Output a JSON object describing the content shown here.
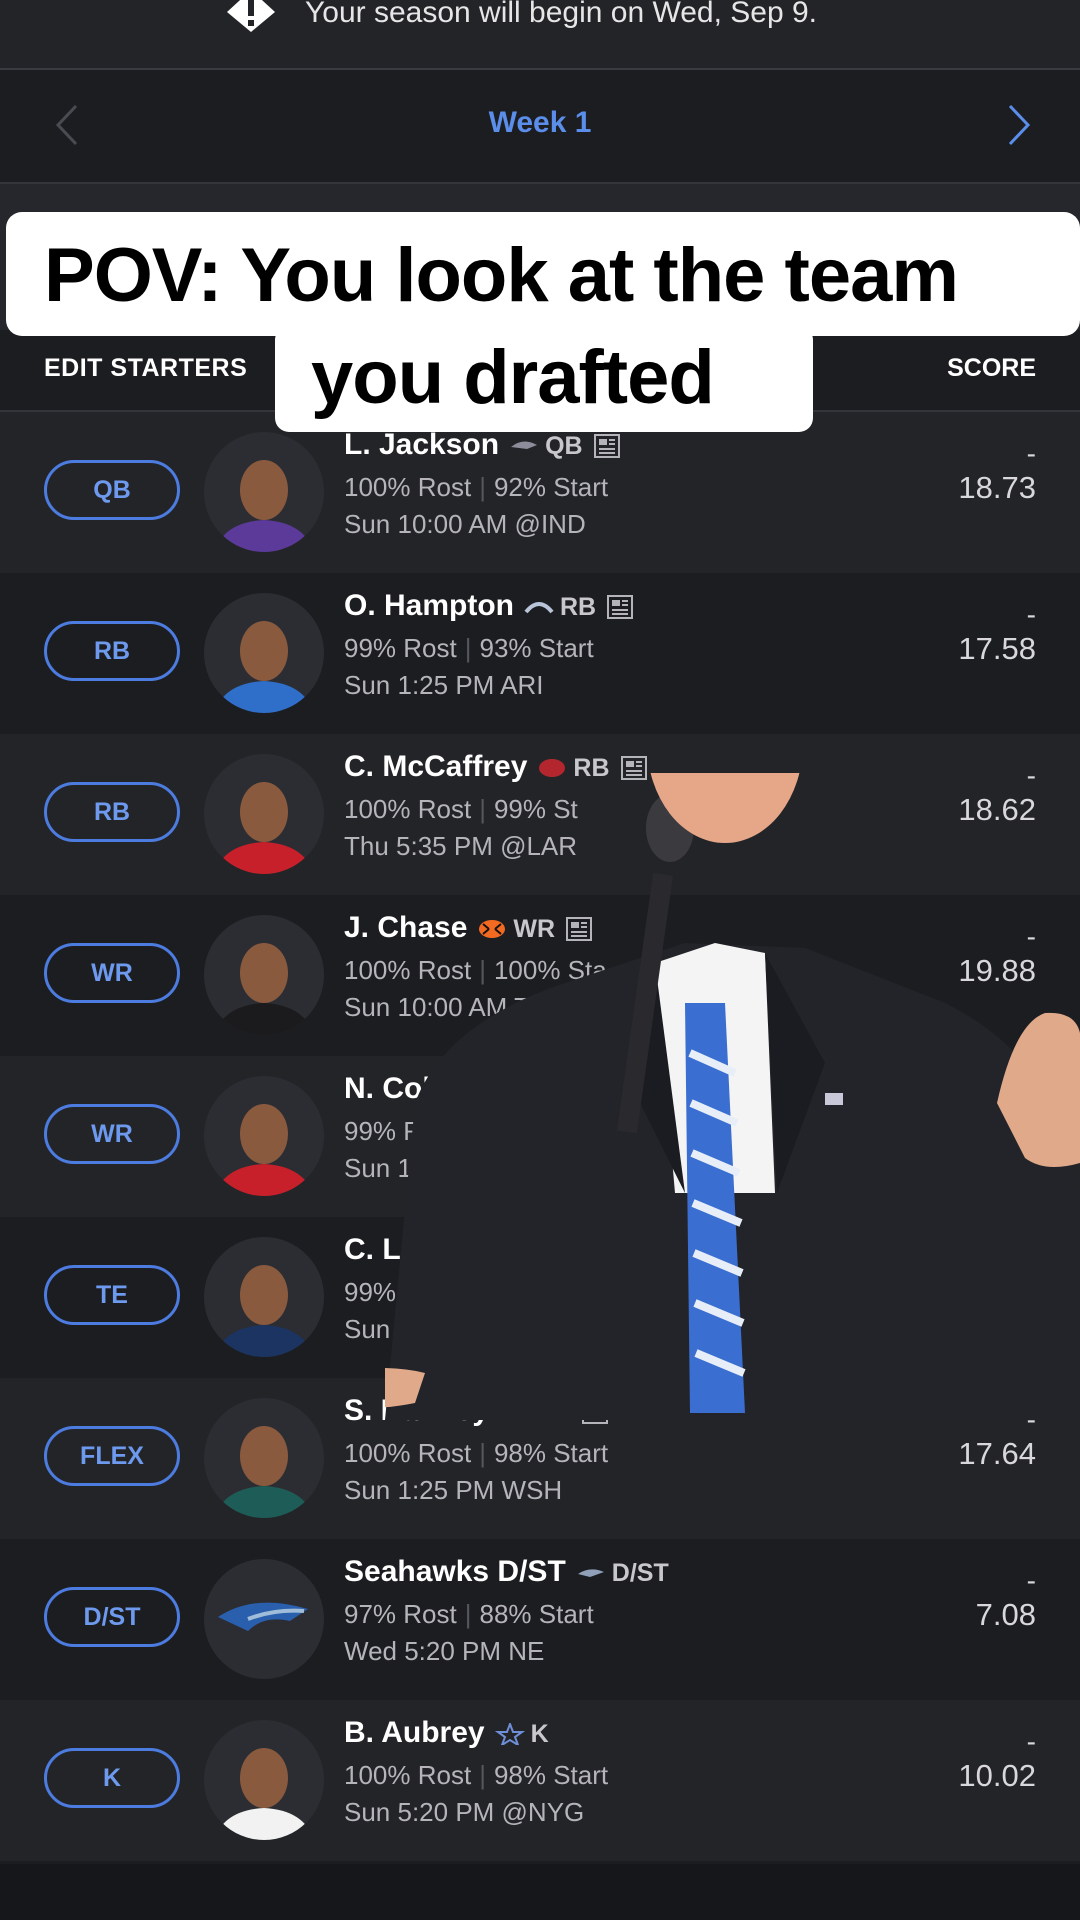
{
  "notice": {
    "text": "Your season will begin on Wed, Sep 9.",
    "icon": "alert-icon"
  },
  "week": {
    "label": "Week 1"
  },
  "caption": {
    "line1": "POV: You look at the team",
    "line2": "you drafted"
  },
  "table_header": {
    "edit_starters": "EDIT STARTERS",
    "score": "SCORE"
  },
  "colors": {
    "accent": "#5b8eea",
    "background": "#1c1d21",
    "row_alt": "#232428"
  },
  "players": [
    {
      "slot": "QB",
      "name": "L. Jackson",
      "position": "QB",
      "rost": "100% Rost",
      "start": "92% Start",
      "game": "Sun 10:00 AM @IND",
      "score": "-",
      "projection": "18.73",
      "team_icon": "ravens-icon"
    },
    {
      "slot": "RB",
      "name": "O. Hampton",
      "position": "RB",
      "rost": "99% Rost",
      "start": "93% Start",
      "game": "Sun 1:25 PM ARI",
      "score": "-",
      "projection": "17.58",
      "team_icon": "chargers-icon"
    },
    {
      "slot": "RB",
      "name": "C. McCaffrey",
      "position": "RB",
      "rost": "100% Rost",
      "start": "99% St",
      "game": "Thu 5:35 PM @LAR",
      "score": "-",
      "projection": "18.62",
      "team_icon": "49ers-icon"
    },
    {
      "slot": "WR",
      "name": "J. Chase",
      "position": "WR",
      "rost": "100% Rost",
      "start": "100% Sta",
      "game": "Sun 10:00 AM TE",
      "score": "-",
      "projection": "19.88",
      "team_icon": "bengals-icon"
    },
    {
      "slot": "WR",
      "name": "N. Collin",
      "position": "",
      "rost": "99% Rost",
      "start": "",
      "game": "Sun 10:0",
      "score": "",
      "projection": "",
      "team_icon": ""
    },
    {
      "slot": "TE",
      "name": "C. Lov",
      "position": "",
      "rost": "99%",
      "start": "",
      "game": "Sun",
      "score": "",
      "projection": "",
      "team_icon": ""
    },
    {
      "slot": "FLEX",
      "name": "S. Barkley",
      "position": "RB",
      "rost": "100% Rost",
      "start": "98% Start",
      "game": "Sun 1:25 PM WSH",
      "score": "-",
      "projection": "17.64",
      "team_icon": "eagles-icon"
    },
    {
      "slot": "D/ST",
      "name": "Seahawks D/ST",
      "position": "D/ST",
      "rost": "97% Rost",
      "start": "88% Start",
      "game": "Wed 5:20 PM NE",
      "score": "-",
      "projection": "7.08",
      "team_icon": "seahawks-icon"
    },
    {
      "slot": "K",
      "name": "B. Aubrey",
      "position": "K",
      "rost": "100% Rost",
      "start": "98% Start",
      "game": "Sun 5:20 PM @NYG",
      "score": "-",
      "projection": "10.02",
      "team_icon": "cowboys-star-icon"
    }
  ]
}
